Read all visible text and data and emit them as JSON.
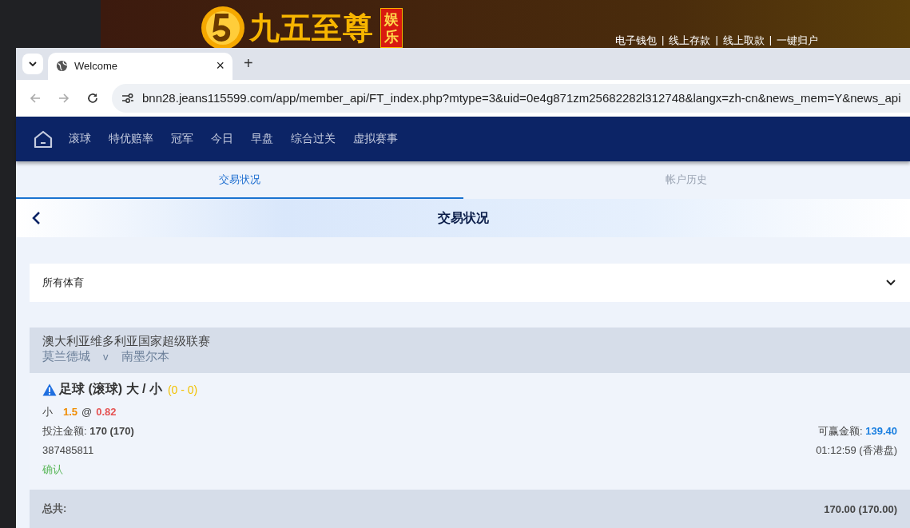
{
  "site_banner": {
    "logo_text": "九五至尊",
    "logo_badge": "娱乐",
    "links": [
      {
        "label": "电子钱包"
      },
      {
        "label": "线上存款"
      },
      {
        "label": "线上取款"
      },
      {
        "label": "一键归户"
      }
    ],
    "separator": "|"
  },
  "browser": {
    "tabs": [
      {
        "title": "Welcome",
        "selected": true
      }
    ],
    "new_tab": "+",
    "close": "×",
    "url": "bnn28.jeans115599.com/app/member_api/FT_index.php?mtype=3&uid=0e4g871zm25682282l312748&langx=zh-cn&news_mem=Y&news_api"
  },
  "nav": {
    "items": [
      {
        "label": "滚球"
      },
      {
        "label": "特优赔率"
      },
      {
        "label": "冠军"
      },
      {
        "label": "今日"
      },
      {
        "label": "早盘"
      },
      {
        "label": "综合过关"
      },
      {
        "label": "虚拟赛事"
      }
    ]
  },
  "page_tabs": [
    {
      "label": "交易状况",
      "selected": true
    },
    {
      "label": "帐户历史",
      "selected": false
    }
  ],
  "header": {
    "title": "交易状况"
  },
  "filter": {
    "value": "所有体育"
  },
  "bet": {
    "league": "澳大利亚维多利亚国家超级联赛",
    "home": "莫兰德城",
    "vs": "v",
    "away": "南墨尔本",
    "market": "足球 (滚球) 大 / 小",
    "score": "(0 - 0)",
    "pick": "小",
    "line": "1.5",
    "at": "@",
    "odds": "0.82",
    "stake_label": "投注金额:",
    "stake": "170 (170)",
    "win_label": "可赢金额:",
    "win": "139.40",
    "ticket": "387485811",
    "time": "01:12:59 (香港盘)",
    "status": "确认"
  },
  "total": {
    "label": "总共:",
    "value": "170.00 (170.00)"
  }
}
